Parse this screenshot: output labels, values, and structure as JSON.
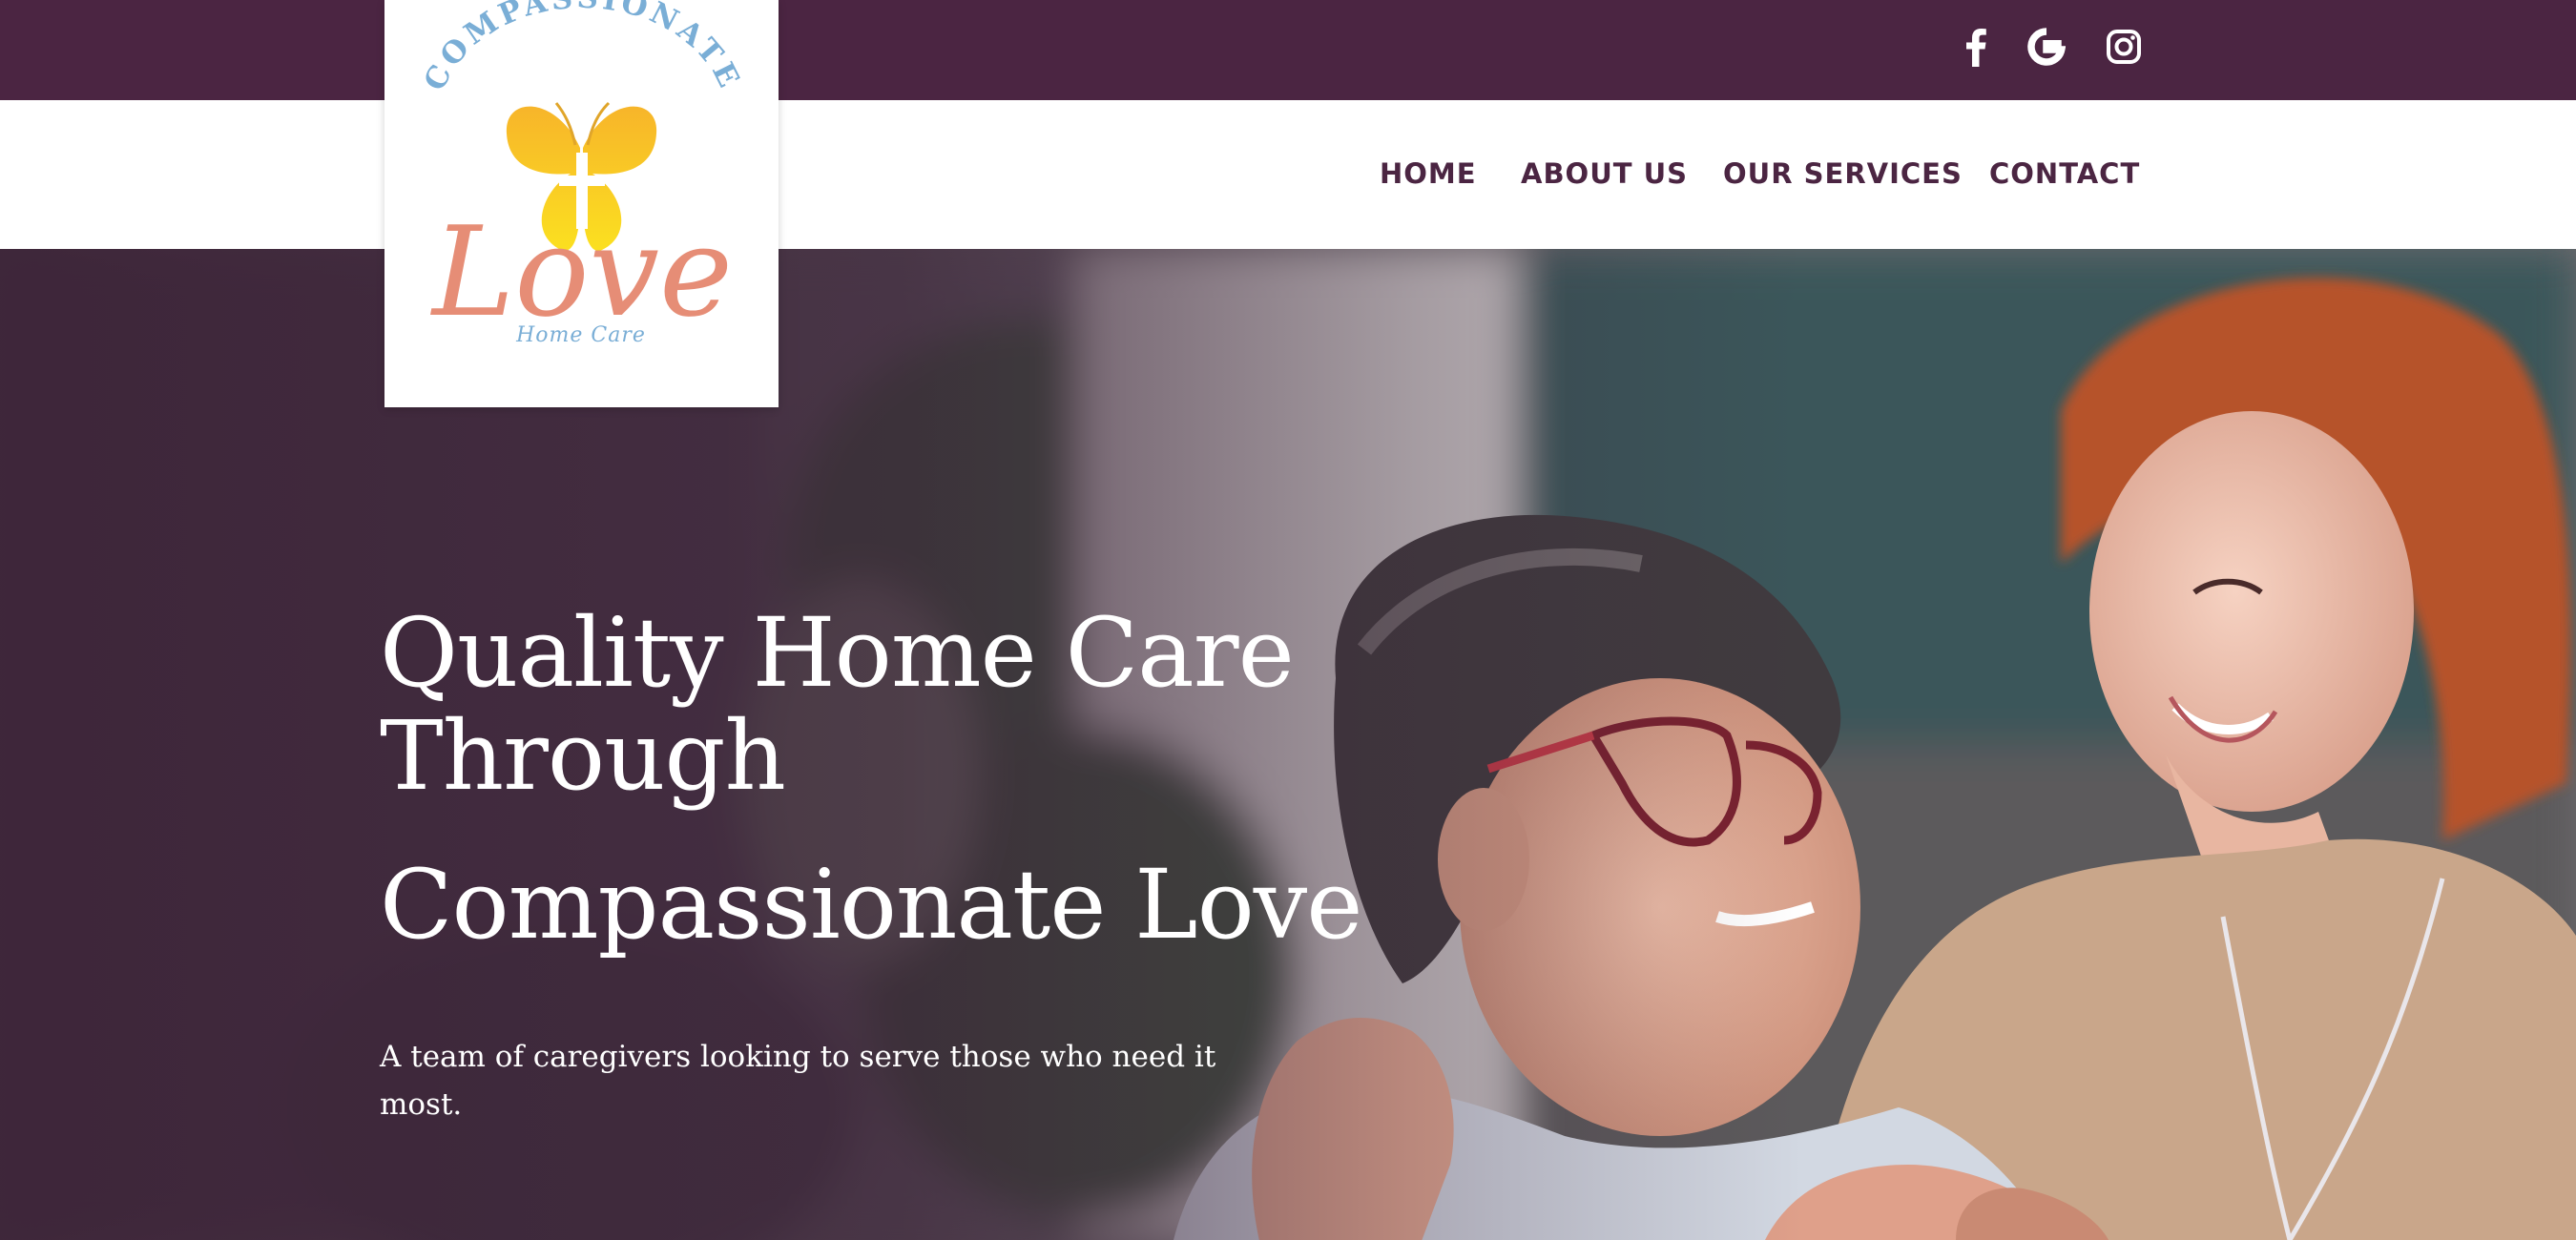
{
  "header": {
    "social": [
      {
        "name": "facebook",
        "icon": "facebook-icon"
      },
      {
        "name": "google",
        "icon": "google-icon"
      },
      {
        "name": "instagram",
        "icon": "instagram-icon"
      }
    ],
    "nav": [
      {
        "label": "HOME"
      },
      {
        "label": "ABOUT US"
      },
      {
        "label": "OUR SERVICES"
      },
      {
        "label": "CONTACT"
      }
    ]
  },
  "logo": {
    "arc_text": "COMPASSIONATE",
    "script_text": "Love",
    "tagline": "Home Care",
    "icon": "butterfly-cross-icon"
  },
  "hero": {
    "title_line1": "Quality Home Care",
    "title_line2": "Through",
    "title_line3": "Compassionate Love",
    "subtitle": "A team of caregivers looking to serve those who need it most.",
    "image": "caregiver-with-senior-woman"
  },
  "colors": {
    "brand_plum": "#4b2542",
    "logo_blue": "#7aaed6",
    "logo_gold": "#f6c21c",
    "logo_salmon": "#e68d76"
  }
}
